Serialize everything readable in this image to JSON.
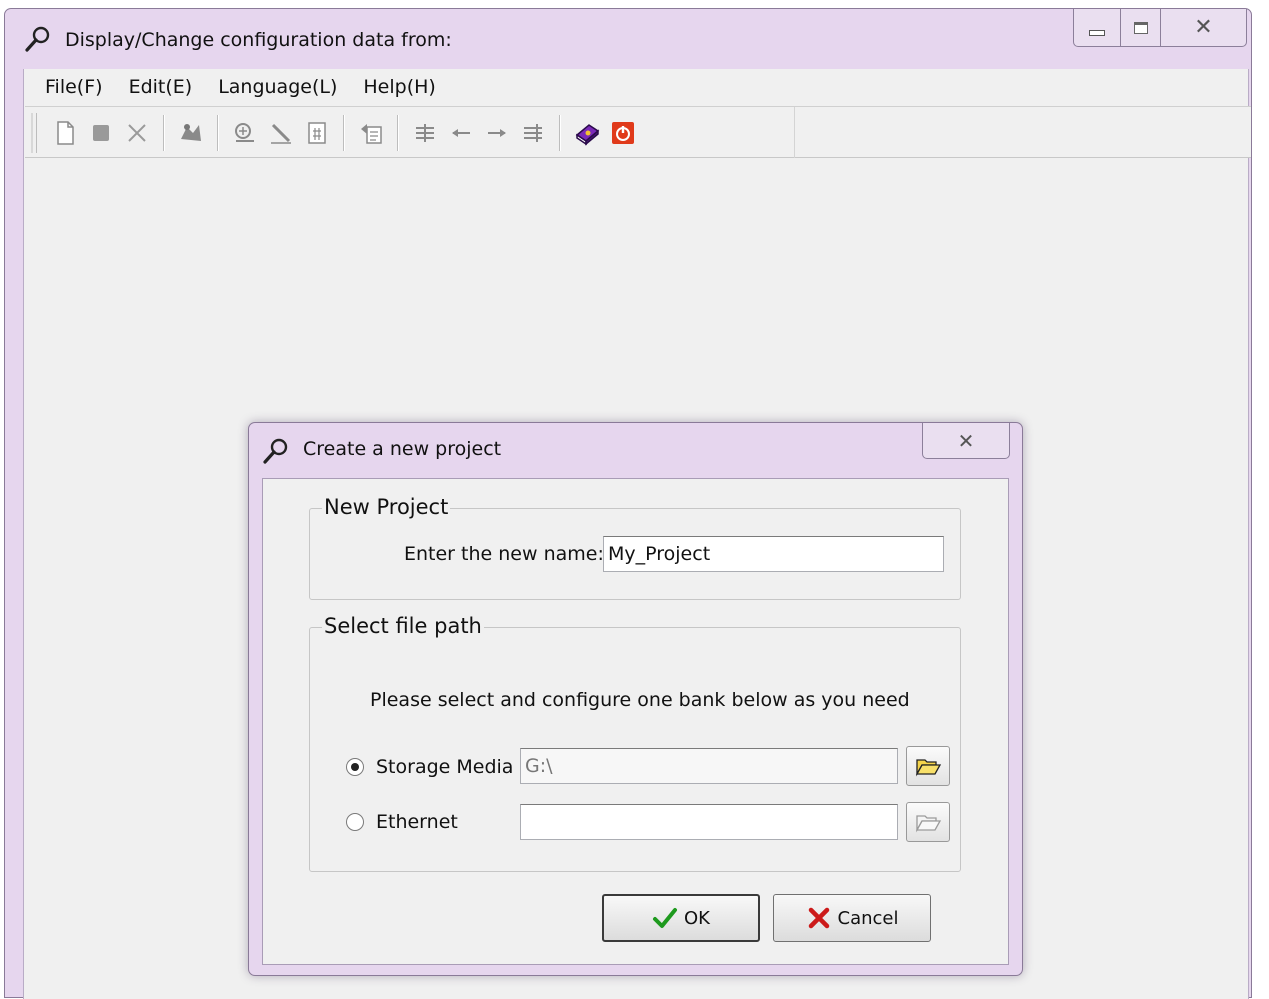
{
  "main_window": {
    "title": "Display/Change configuration data from:",
    "menu": [
      {
        "label": "File(F)"
      },
      {
        "label": "Edit(E)"
      },
      {
        "label": "Language(L)"
      },
      {
        "label": "Help(H)"
      }
    ],
    "toolbar_icons": [
      "new-file-icon",
      "stop-icon",
      "delete-icon",
      "transfer-icon",
      "find-icon",
      "edit-icon",
      "calculator-icon",
      "copy-icon",
      "align-center-icon",
      "arrow-left-icon",
      "arrow-right-icon",
      "align-icon",
      "help-book-icon",
      "power-exit-icon"
    ]
  },
  "dialog": {
    "title": "Create a new project",
    "new_project": {
      "legend": "New Project",
      "name_label": "Enter the new name:",
      "name_value": "My_Project"
    },
    "file_path": {
      "legend": "Select file path",
      "instruction": "Please select and configure one bank below as you need",
      "storage_media": {
        "label": "Storage Media",
        "value": "G:\\",
        "selected": true
      },
      "ethernet": {
        "label": "Ethernet",
        "value": "",
        "selected": false
      }
    },
    "buttons": {
      "ok": "OK",
      "cancel": "Cancel"
    }
  },
  "colors": {
    "chrome": "#e6d6ee",
    "panel": "#f0f0f0",
    "ok_check": "#1e9a1e",
    "cancel_x": "#cc1a1a",
    "exit_red": "#e03a1a"
  }
}
